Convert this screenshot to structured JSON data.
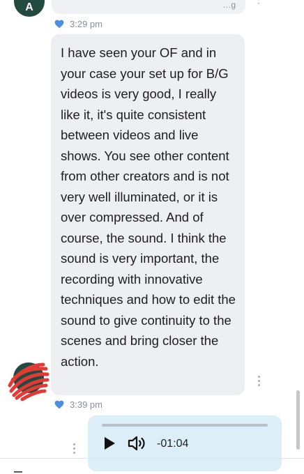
{
  "previous_message": {
    "avatar_initial": "A",
    "time": "3:29 pm",
    "liked": true
  },
  "message": {
    "text": "I have seen your OF and in your case your set up for B/G videos is very good, I really like it, it's quite consistent between videos and live shows. You see other content from other creators and is not very well illuminated, or it is over compressed. And of course, the sound. I think the sound is very important, the recording with innovative techniques and how to edit the sound to give continuity to the scenes and bring closer the action.",
    "time": "3:39 pm",
    "liked": true
  },
  "audio_message": {
    "remaining_time": "-01:04",
    "progress": 0
  },
  "icons": {
    "like": "heart-icon",
    "menu": "more-vertical-icon",
    "play": "play-icon",
    "volume": "volume-icon"
  },
  "colors": {
    "like": "#4a8fe0",
    "incoming_bubble": "#eeeff3",
    "outgoing_bubble": "#dceef8",
    "avatar": "#234a3f",
    "redaction_scribble": "#e53935"
  }
}
